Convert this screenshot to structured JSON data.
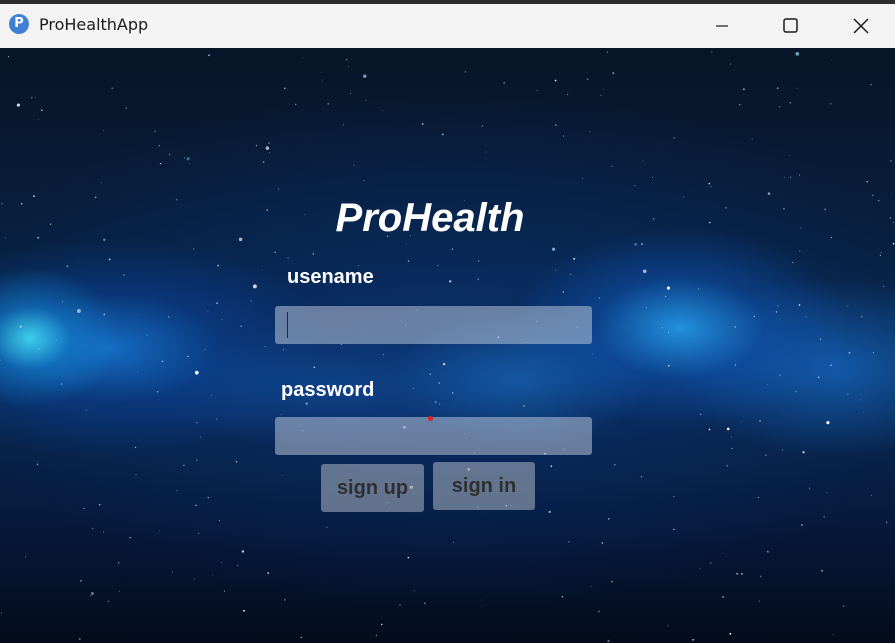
{
  "window": {
    "title": "ProHealthApp",
    "icon": "app-logo-icon",
    "icon_letter": "P",
    "controls": [
      "minimize-icon",
      "maximize-icon",
      "close-icon"
    ]
  },
  "login": {
    "heading": "ProHealth",
    "username_label": "usename",
    "username_value": "",
    "password_label": "password",
    "password_value": "",
    "signup_label": "sign up",
    "signin_label": "sign in"
  },
  "colors": {
    "background": "#071a36",
    "accent_glow": "#3cc8ff",
    "input_fill": "#c8d2e1",
    "button_fill": "#a0aab9",
    "button_text": "#2f2f2f",
    "marker": "#e0211c"
  }
}
